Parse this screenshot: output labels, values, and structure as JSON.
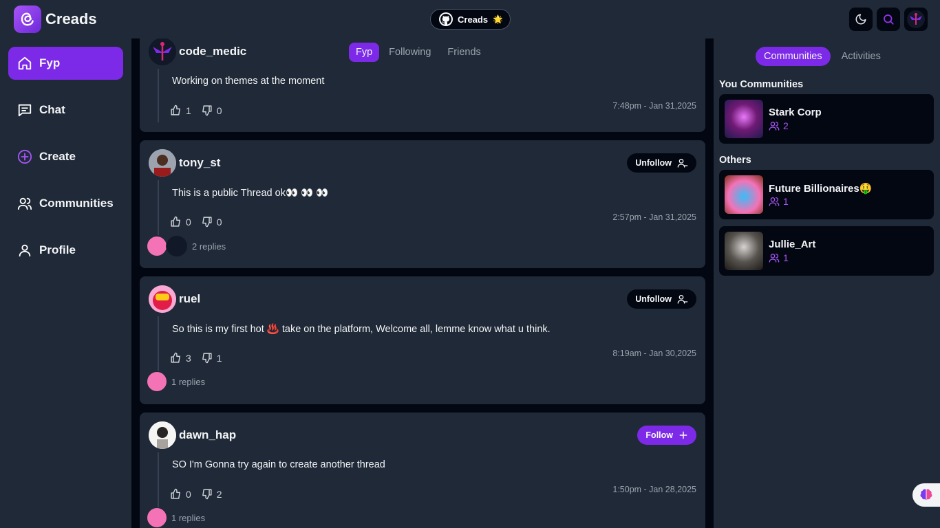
{
  "app": {
    "name": "Creads"
  },
  "header": {
    "github_label": "Creads",
    "github_emoji": "🌟"
  },
  "sidebar": {
    "items": [
      {
        "label": "Fyp",
        "icon": "home-icon",
        "active": true
      },
      {
        "label": "Chat",
        "icon": "chat-icon",
        "active": false
      },
      {
        "label": "Create",
        "icon": "plus-circle-icon",
        "active": false
      },
      {
        "label": "Communities",
        "icon": "users-icon",
        "active": false
      },
      {
        "label": "Profile",
        "icon": "user-icon",
        "active": false
      }
    ]
  },
  "feed_tabs": [
    {
      "label": "Fyp",
      "active": true
    },
    {
      "label": "Following",
      "active": false
    },
    {
      "label": "Friends",
      "active": false
    }
  ],
  "posts": [
    {
      "username": "code_medic",
      "text": "Working on themes at the moment",
      "likes": "1",
      "dislikes": "0",
      "time": "7:48pm - Jan 31,2025",
      "button": "",
      "replies": ""
    },
    {
      "username": "tony_st",
      "text": "This is a public Thread ok👀 👀 👀",
      "likes": "0",
      "dislikes": "0",
      "time": "2:57pm - Jan 31,2025",
      "button": "Unfollow",
      "replies": "2 replies"
    },
    {
      "username": "ruel",
      "text": "So this is my first hot ♨️ take on the platform, Welcome all, lemme know what u think.",
      "likes": "3",
      "dislikes": "1",
      "time": "8:19am - Jan 30,2025",
      "button": "Unfollow",
      "replies": "1 replies"
    },
    {
      "username": "dawn_hap",
      "text": "SO I'm Gonna try again to create another thread",
      "likes": "0",
      "dislikes": "2",
      "time": "1:50pm - Jan 28,2025",
      "button": "Follow",
      "replies": "1 replies"
    }
  ],
  "right_panel": {
    "tabs": [
      {
        "label": "Communities",
        "active": true
      },
      {
        "label": "Activities",
        "active": false
      }
    ],
    "your_heading": "You Communities",
    "your_communities": [
      {
        "name": "Stark Corp",
        "members": "2"
      }
    ],
    "others_heading": "Others",
    "others": [
      {
        "name": "Future Billionaires🤑",
        "members": "1"
      },
      {
        "name": "Jullie_Art",
        "members": "1"
      }
    ]
  },
  "colors": {
    "accent": "#7c2ae8",
    "bg_dark": "#030712",
    "panel": "#1f2937"
  }
}
